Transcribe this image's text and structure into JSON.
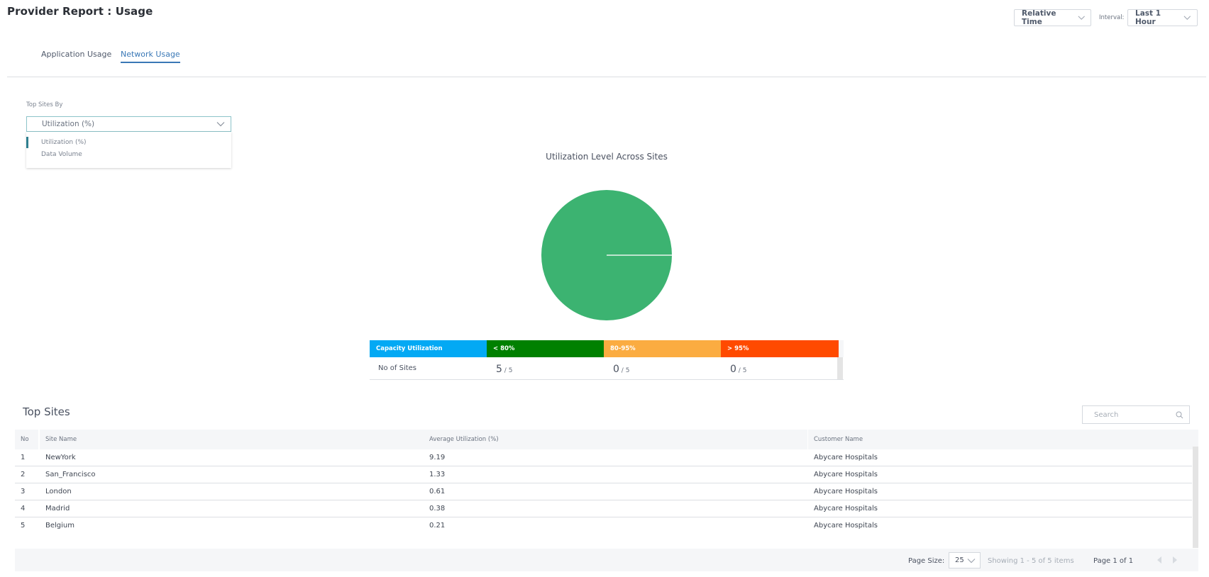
{
  "header": {
    "title": "Provider Report : Usage",
    "time_mode": "Relative Time",
    "interval_label": "Interval:",
    "interval_value": "Last 1 Hour"
  },
  "tabs": [
    {
      "label": "Application Usage",
      "active": false
    },
    {
      "label": "Network Usage",
      "active": true
    }
  ],
  "top_sites_by": {
    "label": "Top Sites By",
    "selected": "Utilization (%)",
    "options": [
      "Utilization (%)",
      "Data Volume"
    ]
  },
  "chart_data": {
    "type": "pie",
    "title": "Utilization Level Across Sites",
    "categories": [
      "< 80%",
      "80-95%",
      "> 95%"
    ],
    "values": [
      5,
      0,
      0
    ],
    "colors": [
      "#3cb371",
      "#fbac41",
      "#ff4a00"
    ]
  },
  "capacity_table": {
    "header_label": "Capacity Utilization",
    "row_label": "No of Sites",
    "total": "5",
    "buckets": [
      {
        "label": "< 80%",
        "count": "5",
        "color": "#008000"
      },
      {
        "label": "80-95%",
        "count": "0",
        "color": "#fbac41"
      },
      {
        "label": "> 95%",
        "count": "0",
        "color": "#ff4a00"
      }
    ],
    "header_color": "#03a9f4"
  },
  "top_sites": {
    "title": "Top Sites",
    "search_placeholder": "Search",
    "columns": [
      "No",
      "Site Name",
      "Average Utilization (%)",
      "Customer Name"
    ],
    "rows": [
      {
        "no": "1",
        "site": "NewYork",
        "avg": "9.19",
        "customer": "Abycare Hospitals"
      },
      {
        "no": "2",
        "site": "San_Francisco",
        "avg": "1.33",
        "customer": "Abycare Hospitals"
      },
      {
        "no": "3",
        "site": "London",
        "avg": "0.61",
        "customer": "Abycare Hospitals"
      },
      {
        "no": "4",
        "site": "Madrid",
        "avg": "0.38",
        "customer": "Abycare Hospitals"
      },
      {
        "no": "5",
        "site": "Belgium",
        "avg": "0.21",
        "customer": "Abycare Hospitals"
      }
    ],
    "footer": {
      "page_size_label": "Page Size:",
      "page_size": "25",
      "showing": "Showing 1 - 5 of 5 items",
      "page": "Page 1 of 1"
    }
  }
}
